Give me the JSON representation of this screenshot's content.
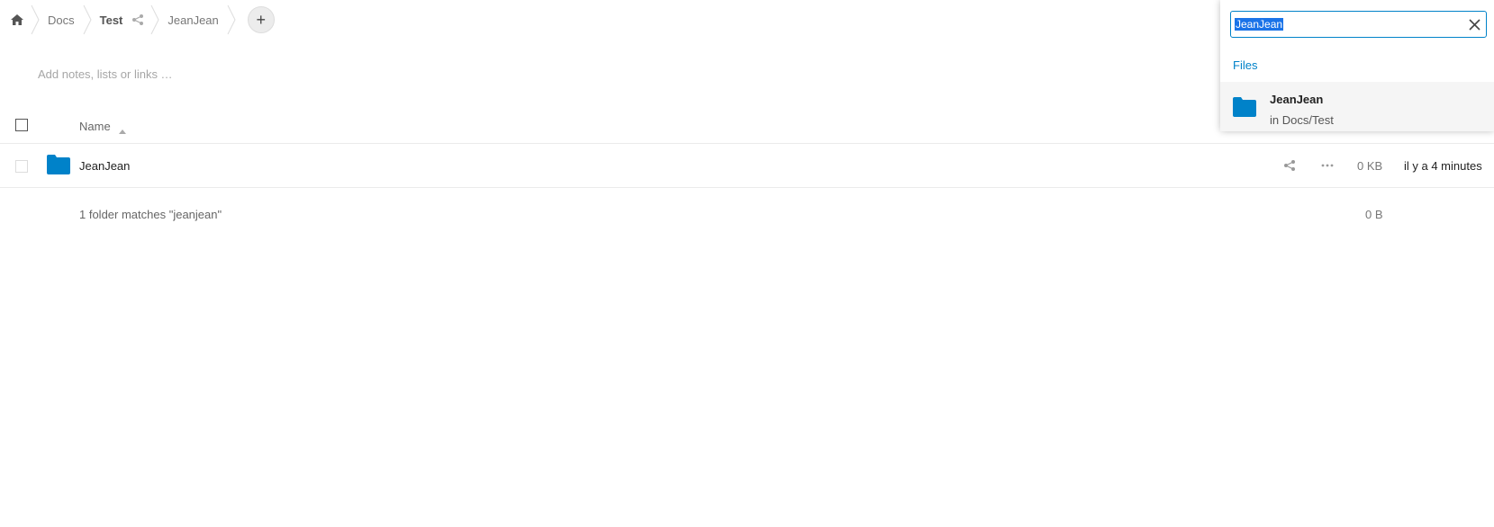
{
  "breadcrumb": {
    "items": [
      {
        "label": "Docs"
      },
      {
        "label": "Test"
      },
      {
        "label": "JeanJean"
      }
    ],
    "add_label": "+"
  },
  "notes": {
    "placeholder": "Add notes, lists or links …"
  },
  "table": {
    "header_name": "Name",
    "rows": [
      {
        "name": "JeanJean",
        "size": "0 KB",
        "modified": "il y a 4 minutes"
      }
    ],
    "summary": "1 folder matches \"jeanjean\"",
    "summary_size": "0 B"
  },
  "search": {
    "value": "JeanJean",
    "section_title": "Files",
    "results": [
      {
        "title": "JeanJean",
        "subtitle": "in Docs/Test"
      }
    ]
  },
  "colors": {
    "accent": "#0082c9",
    "folder": "#0082c9"
  },
  "icons": [
    "home-icon",
    "share-icon",
    "plus-icon",
    "sort-asc-icon",
    "folder-icon",
    "more-icon",
    "close-icon"
  ]
}
